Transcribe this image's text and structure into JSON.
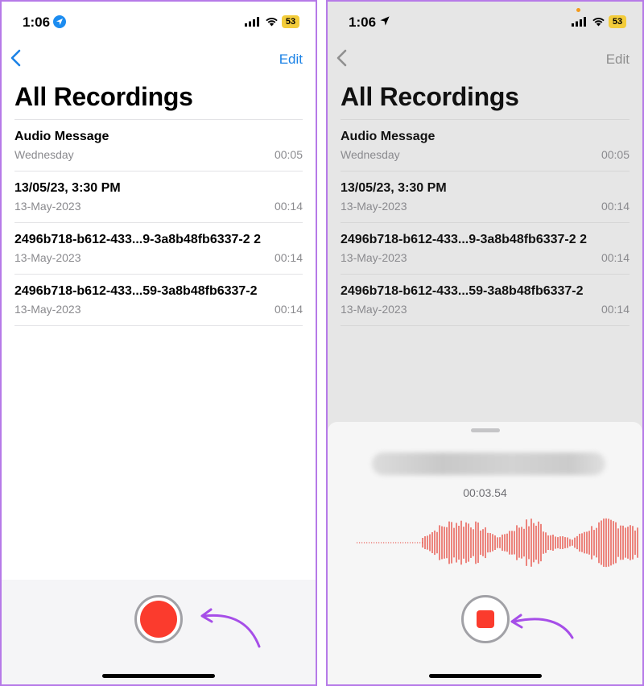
{
  "left": {
    "status": {
      "time": "1:06",
      "battery": "53"
    },
    "nav": {
      "edit": "Edit"
    },
    "title": "All Recordings",
    "recordings": [
      {
        "title": "Audio Message",
        "date": "Wednesday",
        "duration": "00:05"
      },
      {
        "title": "13/05/23, 3:30 PM",
        "date": "13-May-2023",
        "duration": "00:14"
      },
      {
        "title": "2496b718-b612-433...9-3a8b48fb6337-2 2",
        "date": "13-May-2023",
        "duration": "00:14"
      },
      {
        "title": "2496b718-b612-433...59-3a8b48fb6337-2",
        "date": "13-May-2023",
        "duration": "00:14"
      }
    ]
  },
  "right": {
    "status": {
      "time": "1:06",
      "battery": "53"
    },
    "nav": {
      "edit": "Edit"
    },
    "title": "All Recordings",
    "recordings": [
      {
        "title": "Audio Message",
        "date": "Wednesday",
        "duration": "00:05"
      },
      {
        "title": "13/05/23, 3:30 PM",
        "date": "13-May-2023",
        "duration": "00:14"
      },
      {
        "title": "2496b718-b612-433...9-3a8b48fb6337-2 2",
        "date": "13-May-2023",
        "duration": "00:14"
      },
      {
        "title": "2496b718-b612-433...59-3a8b48fb6337-2",
        "date": "13-May-2023",
        "duration": "00:14"
      }
    ],
    "recording_sheet": {
      "elapsed": "00:03.54"
    }
  },
  "colors": {
    "accent": "#1b82e6",
    "record": "#fb3b2d",
    "annotation": "#a64ee8",
    "waveform": "#e8463c"
  },
  "icons": [
    "location-icon",
    "signal-icon",
    "wifi-icon",
    "battery-icon",
    "back-chevron-icon",
    "record-icon",
    "stop-icon",
    "arrow-annotation-icon"
  ]
}
